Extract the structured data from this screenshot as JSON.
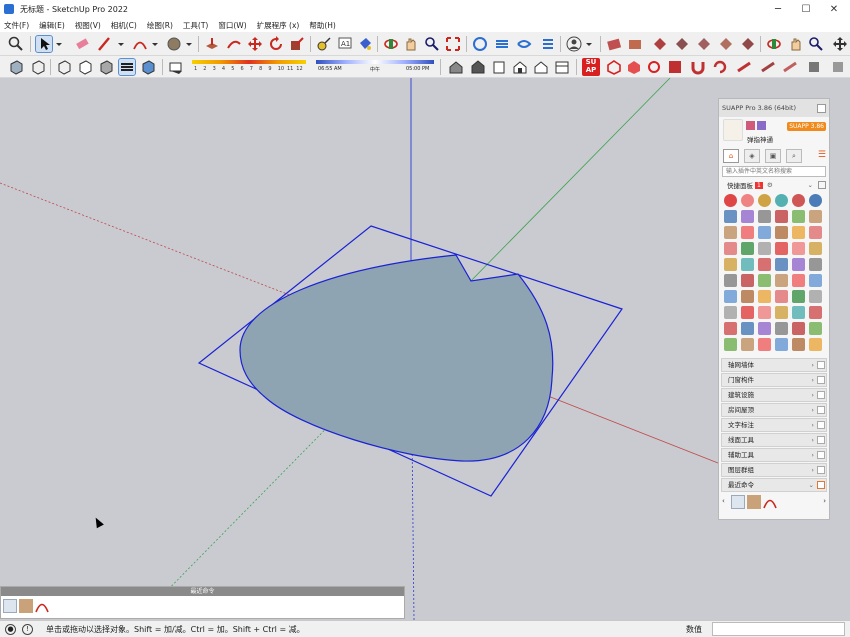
{
  "window": {
    "title": "无标题 - SketchUp Pro 2022"
  },
  "menu": [
    "文件(F)",
    "编辑(E)",
    "视图(V)",
    "相机(C)",
    "绘图(R)",
    "工具(T)",
    "窗口(W)",
    "扩展程序 (x)",
    "帮助(H)"
  ],
  "toolbar": {
    "shadow_scale": [
      "1",
      "2",
      "3",
      "4",
      "5",
      "6",
      "7",
      "8",
      "9",
      "10",
      "11",
      "12"
    ],
    "time_start": "06:55 AM",
    "time_mid": "中午",
    "time_end": "05:00 PM"
  },
  "suapp": {
    "title": "SUAPP Pro 3.86 (64bit)",
    "username": "弹指神通",
    "badge": "SUAPP 3.86",
    "search_placeholder": "输入插件中英文名称搜索",
    "quick_panel": "快捷面板",
    "quick_count": "1",
    "sections": [
      "轴网墙体",
      "门窗构件",
      "建筑设施",
      "房间屋顶",
      "文字标注",
      "线面工具",
      "辅助工具",
      "图层群组",
      "最近命令"
    ]
  },
  "recent_panel": {
    "title": "最近命令"
  },
  "status": {
    "message": "单击或拖动以选择对象。Shift = 加/减。Ctrl = 加。Shift + Ctrl = 减。",
    "value_label": "数值",
    "value": ""
  },
  "colors": {
    "viewport_bg": "#c9cbd1",
    "edge_blue": "#1a22d4",
    "face_fill": "#8fa4b2",
    "axis_red": "#c04848",
    "axis_green": "#3fa24f",
    "axis_blue": "#2a3bd0"
  }
}
